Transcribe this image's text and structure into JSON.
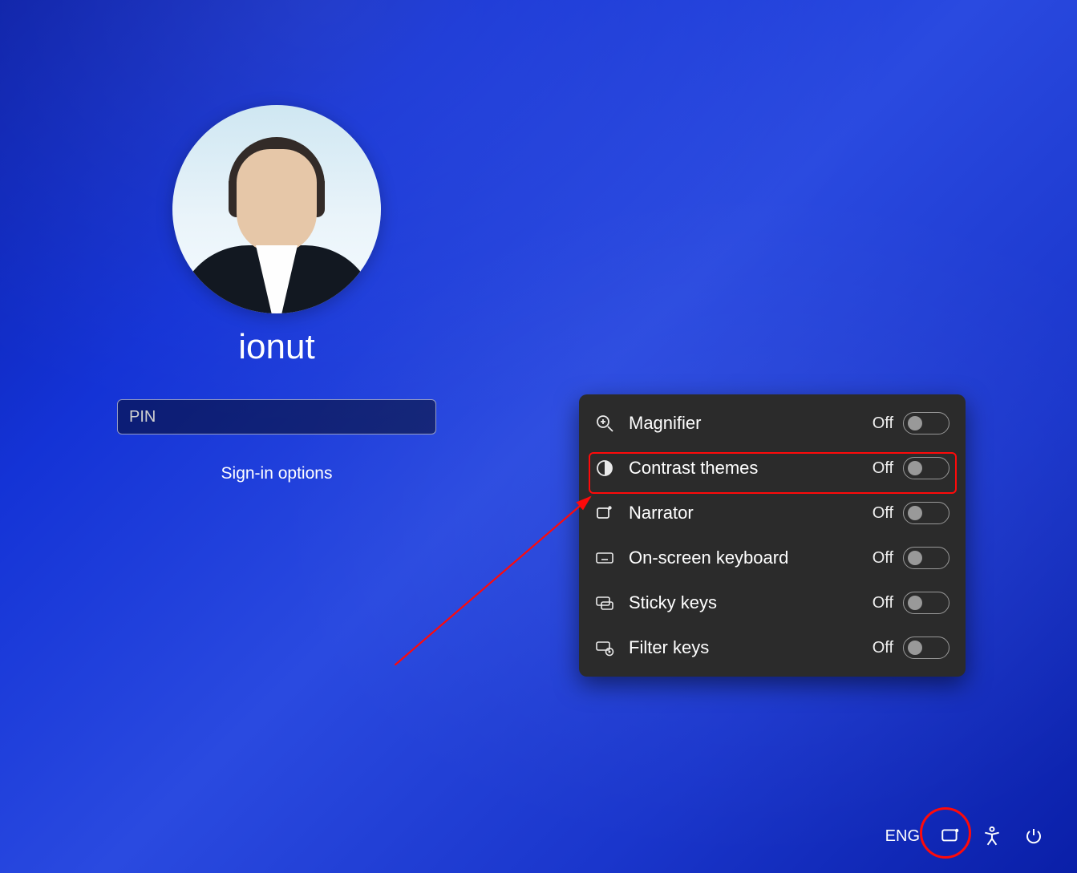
{
  "user": {
    "name": "ionut"
  },
  "pin_field": {
    "placeholder": "PIN"
  },
  "sign_in_options_label": "Sign-in options",
  "accessibility": {
    "off_label": "Off",
    "items": [
      {
        "label": "Magnifier",
        "state": "Off",
        "icon": "magnifier-plus-icon"
      },
      {
        "label": "Contrast themes",
        "state": "Off",
        "icon": "contrast-icon"
      },
      {
        "label": "Narrator",
        "state": "Off",
        "icon": "narrator-icon"
      },
      {
        "label": "On-screen keyboard",
        "state": "Off",
        "icon": "keyboard-icon"
      },
      {
        "label": "Sticky keys",
        "state": "Off",
        "icon": "sticky-keys-icon"
      },
      {
        "label": "Filter keys",
        "state": "Off",
        "icon": "filter-keys-icon"
      }
    ]
  },
  "taskbar": {
    "language": "ENG"
  },
  "annotation": {
    "highlight_color": "#ff0a0a"
  }
}
